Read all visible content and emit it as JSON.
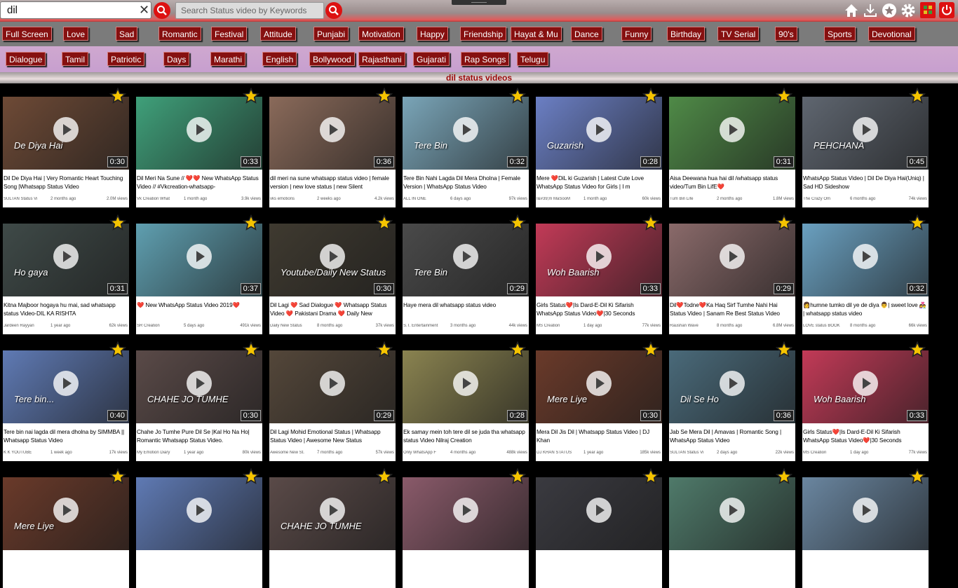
{
  "search": {
    "value": "dil",
    "keyword_placeholder": "Search Status video by Keywords"
  },
  "toolbar": {
    "icons": [
      "home-icon",
      "download-icon",
      "favorite-icon",
      "gear-icon",
      "grid-icon",
      "power-icon"
    ]
  },
  "categories_row1": [
    "Full Screen",
    "Love",
    "Sad",
    "Romantic",
    "Festival",
    "Attitude",
    "Punjabi",
    "Motivation",
    "Happy",
    "Friendship",
    "Hayat & Mu",
    "Dance",
    "Funny",
    "Birthday",
    "TV Serial",
    "90's",
    "Sports",
    "Devotional"
  ],
  "categories_row2": [
    "Dialogue",
    "Tamil",
    "Patriotic",
    "Days",
    "Marathi",
    "English",
    "Bollywood",
    "Rajasthani",
    "Gujarati",
    "Rap Songs",
    "Telugu"
  ],
  "page_title": "dil status videos",
  "videos": [
    {
      "title": "Dil De Diya Hai | Very Romantic Heart Touching Song |Whatsapp Status Video",
      "channel": "SULTAN Status Vi",
      "ago": "2 months ago",
      "views": "2.0M views",
      "duration": "0:30",
      "color": "#6e4a36",
      "overlay": "De Diya Hai"
    },
    {
      "title": "Dil Meri Na Sune // ❤️❤️ New WhatsApp Status Video // #Vkcreation-whatsapp-",
      "channel": "Vk Creation What",
      "ago": "1 month ago",
      "views": "3.9k views",
      "duration": "0:33",
      "color": "#3fa07a",
      "overlay": ""
    },
    {
      "title": "dil meri na sune whatsapp status video | female version | new love status | new Silent",
      "channel": "vks emotions",
      "ago": "2 weeks ago",
      "views": "4.2k views",
      "duration": "0:36",
      "color": "#8a6a5a",
      "overlay": ""
    },
    {
      "title": "Tere Bin Nahi Lagda Dil Mera Dholna | Female Version | WhatsApp Status Video",
      "channel": "ALL IN ONE",
      "ago": "6 days ago",
      "views": "97k views",
      "duration": "0:32",
      "color": "#7aa5b8",
      "overlay": "Tere Bin"
    },
    {
      "title": "Mere ❤️DiL ki Guzarish | Latest Cute Love WhatsApp Status Video for Girls | I m",
      "channel": "I&#39;m MaSooM",
      "ago": "1 month ago",
      "views": "60k views",
      "duration": "0:28",
      "color": "#6b7fc4",
      "overlay": "Guzarish"
    },
    {
      "title": "Aisa Deewana hua hai dil /whatsapp status video/Tum Bin LifE❤️",
      "channel": "Tum Bin Life",
      "ago": "2 months ago",
      "views": "1.8M views",
      "duration": "0:31",
      "color": "#4f8a47",
      "overlay": ""
    },
    {
      "title": "WhatsApp Status Video | Dil De Diya Hai(Uniq) | Sad HD Sideshow",
      "channel": "The Crazy Om",
      "ago": "6 months ago",
      "views": "74k views",
      "duration": "0:45",
      "color": "#5f6670",
      "overlay": "PEHCHANA"
    },
    {
      "title": "Kitna Majboor hogaya hu mai, sad whatsapp status Video-DIL KA RISHTA",
      "channel": "Jardeen Rayyan",
      "ago": "1 year ago",
      "views": "62k views",
      "duration": "0:31",
      "color": "#3f4a48",
      "overlay": "Ho gaya"
    },
    {
      "title": "❤️ New WhatsApp Status Video 2019❤️",
      "channel": "SR Creation",
      "ago": "5 days ago",
      "views": "491k views",
      "duration": "0:37",
      "color": "#5f9fb0",
      "overlay": ""
    },
    {
      "title": "Dil Lagi ❤️ Sad Dialogue ❤️ Whatsapp Status Video ❤️ Pakistani Drama ❤️ Daily New",
      "channel": "Daily New Status",
      "ago": "8 months ago",
      "views": "37k views",
      "duration": "0:30",
      "color": "#3f3a30",
      "overlay": "Youtube/Daily New Status"
    },
    {
      "title": "Haye mera dil whatsapp status video",
      "channel": "S.T. Entertainment",
      "ago": "3 months ago",
      "views": "44k views",
      "duration": "0:29",
      "color": "#4a4a4a",
      "overlay": "Tere Bin"
    },
    {
      "title": "Girls Status❤️|Is Dard-E-Dil Ki Sifarish WhatsApp Status Video❤️|30 Seconds",
      "channel": "MS Creation",
      "ago": "1 day ago",
      "views": "77k views",
      "duration": "0:33",
      "color": "#c23a57",
      "overlay": "Woh Baarish"
    },
    {
      "title": "Dil❤️Todne❤️Ka Haq Sirf Tumhe Nahi Hai Status Video | Sanam Re Best Status Video",
      "channel": "Raushan Wave",
      "ago": "8 months ago",
      "views": "6.8M views",
      "duration": "0:29",
      "color": "#8a6a6a",
      "overlay": ""
    },
    {
      "title": "👩humne tumko dil ye de diya 👨| sweet love 👩‍❤️‍👨 | whatsapp status video",
      "channel": "LOVE status BOOK",
      "ago": "8 months ago",
      "views": "66k views",
      "duration": "0:32",
      "color": "#6aa0c0",
      "overlay": ""
    },
    {
      "title": "Tere bin nai lagda dil mera dholna by SIMMBA || Whatsapp Status Video",
      "channel": "K K YOUTUBE",
      "ago": "1 week ago",
      "views": "17k views",
      "duration": "0:40",
      "color": "#5f7ab4",
      "overlay": "Tere bin..."
    },
    {
      "title": "Chahe Jo Tumhe Pure Dil Se |Kal Ho Na Ho| Romantic Whatsapp Status Video.",
      "channel": "My Emotion Diary",
      "ago": "1 year ago",
      "views": "80k views",
      "duration": "0:30",
      "color": "#5a4a48",
      "overlay": "CHAHE JO TUMHE"
    },
    {
      "title": "Dil Lagi Mohid Emotional Status | Whatsapp Status Video | Awesome New Status",
      "channel": "Awesome New St.",
      "ago": "7 months ago",
      "views": "57k views",
      "duration": "0:29",
      "color": "#54473a",
      "overlay": ""
    },
    {
      "title": "Ek samay mein toh tere dil se juda tha whatsapp status Video Nilraj Creation",
      "channel": "Only WhatsApp F",
      "ago": "4 months ago",
      "views": "488k views",
      "duration": "0:28",
      "color": "#8a8350",
      "overlay": ""
    },
    {
      "title": "Mera Dil Jis Dil | Whatsapp Status Video | DJ Khan",
      "channel": "DJ KHAN STATUS",
      "ago": "1 year ago",
      "views": "185k views",
      "duration": "0:30",
      "color": "#6a3a2a",
      "overlay": "Mere Liye"
    },
    {
      "title": "Jab Se Mera Dil | Amavas | Romantic Song | WhatsApp Status Video",
      "channel": "SULTAN Status Vi",
      "ago": "2 days ago",
      "views": "22k views",
      "duration": "0:36",
      "color": "#4a6a7a",
      "overlay": "Dil Se Ho"
    },
    {
      "title": "Girls Status❤️|Is Dard-E-Dil Ki Sifarish WhatsApp Status Video❤️|30 Seconds",
      "channel": "MS Creation",
      "ago": "1 day ago",
      "views": "77k views",
      "duration": "0:33",
      "color": "#c23a57",
      "overlay": "Woh Baarish"
    },
    {
      "title": "",
      "channel": "",
      "ago": "",
      "views": "",
      "duration": "",
      "color": "#6a3a2a",
      "overlay": "Mere Liye"
    },
    {
      "title": "",
      "channel": "",
      "ago": "",
      "views": "",
      "duration": "",
      "color": "#5f7ab4",
      "overlay": ""
    },
    {
      "title": "",
      "channel": "",
      "ago": "",
      "views": "",
      "duration": "",
      "color": "#5a4a48",
      "overlay": "CHAHE JO TUMHE"
    },
    {
      "title": "",
      "channel": "",
      "ago": "",
      "views": "",
      "duration": "",
      "color": "#8a5a6a",
      "overlay": ""
    },
    {
      "title": "",
      "channel": "",
      "ago": "",
      "views": "",
      "duration": "",
      "color": "#3a3a40",
      "overlay": ""
    },
    {
      "title": "",
      "channel": "",
      "ago": "",
      "views": "",
      "duration": "",
      "color": "#4f7a6a",
      "overlay": ""
    },
    {
      "title": "",
      "channel": "",
      "ago": "",
      "views": "",
      "duration": "",
      "color": "#6a86a0",
      "overlay": ""
    }
  ]
}
